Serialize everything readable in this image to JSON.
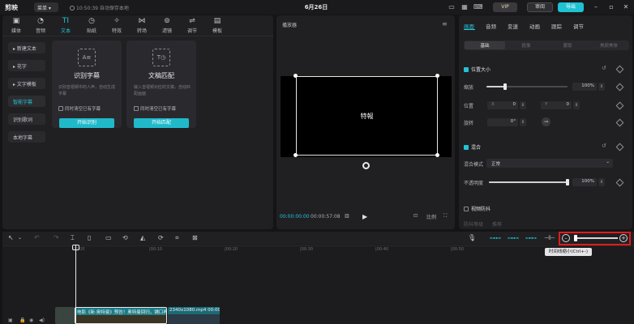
{
  "app": {
    "logo": "剪映",
    "menu_label": "菜单 ▾",
    "autosave": "10:50:39 自动保存本地",
    "project_title": "6月26日",
    "vip_label": "VIP",
    "review_label": "审阅",
    "export_label": "导出"
  },
  "tool_tabs": [
    {
      "icon": "▣",
      "label": "媒体"
    },
    {
      "icon": "◔",
      "label": "音频"
    },
    {
      "icon": "TI",
      "label": "文本"
    },
    {
      "icon": "◷",
      "label": "贴纸"
    },
    {
      "icon": "✧",
      "label": "特效"
    },
    {
      "icon": "⋈",
      "label": "转场"
    },
    {
      "icon": "⊚",
      "label": "滤镜"
    },
    {
      "icon": "⇌",
      "label": "调节"
    },
    {
      "icon": "▤",
      "label": "模板"
    }
  ],
  "text_sidebar": [
    {
      "label": "▸ 新建文本"
    },
    {
      "label": "▸ 花字"
    },
    {
      "label": "▸ 文字模板"
    },
    {
      "label": "智能字幕"
    },
    {
      "label": "识别歌词"
    },
    {
      "label": "本地字幕"
    }
  ],
  "cards": [
    {
      "icon": "A≡",
      "title": "识别字幕",
      "desc": "识别音视频中的人声，自动生成字幕",
      "check": "同时清空已有字幕",
      "button": "开始识别"
    },
    {
      "icon": "T◷",
      "title": "文稿匹配",
      "desc": "输入音视频对应的文稿，自动匹配画面",
      "check": "同时清空已有字幕",
      "button": "开始匹配"
    }
  ],
  "player": {
    "title": "播放器",
    "overlay_text": "特報",
    "time_current": "00:00:00:00",
    "time_total": "00:00:57:08",
    "ratio_label": "比例"
  },
  "props": {
    "tabs": [
      "画面",
      "音频",
      "变速",
      "动画",
      "跟踪",
      "调节"
    ],
    "sub_tabs": [
      "基础",
      "抠像",
      "蒙版",
      "美颜美体"
    ],
    "position_size": "位置大小",
    "scale_label": "缩放",
    "scale_value": "100%",
    "scale_fraction": 0.5,
    "position_label": "位置",
    "x_label": "X",
    "x_value": "0",
    "y_label": "Y",
    "y_value": "0",
    "rotate_label": "旋转",
    "rotate_value": "0°",
    "blend_title": "混合",
    "blend_mode_label": "混合模式",
    "blend_mode_value": "正常",
    "opacity_label": "不透明度",
    "opacity_value": "100%",
    "opacity_fraction": 1.0,
    "stabilize_title": "视频防抖",
    "stabilize_label": "防抖等级",
    "stabilize_value": "推荐"
  },
  "timeline": {
    "ruler": [
      "00:00",
      "|00:10",
      "|00:20",
      "|00:30",
      "|00:40",
      "|00:50"
    ],
    "tooltip": "时间线缩小(Ctrl+-)",
    "clip1_label": "电影《新·奥特曼》预告！奥特曼回归，铺口再现 剧集",
    "clip2_label": "2340x1080.mp4  00:00:57"
  },
  "colors": {
    "accent": "#21c4d6",
    "highlight_box": "#e21b1b"
  }
}
